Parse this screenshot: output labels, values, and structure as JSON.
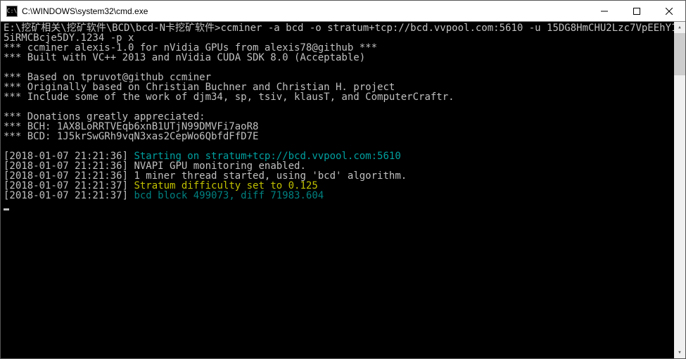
{
  "titlebar": {
    "icon_text": "C:\\",
    "title": "C:\\WINDOWS\\system32\\cmd.exe"
  },
  "terminal": {
    "prompt_path": "E:\\挖矿相关\\挖矿软件\\BCD\\bcd-N卡挖矿软件>",
    "command": "ccminer -a bcd -o stratum+tcp://bcd.vvpool.com:5610 -u 15DG8HmCHU2Lzc7VpEEhY15iRMCBcje5DY.1234 -p x",
    "banner": [
      "*** ccminer alexis-1.0 for nVidia GPUs from alexis78@github ***",
      "*** Built with VC++ 2013 and nVidia CUDA SDK 8.0 (Acceptable)",
      "",
      "*** Based on tpruvot@github ccminer",
      "*** Originally based on Christian Buchner and Christian H. project",
      "*** Include some of the work of djm34, sp, tsiv, klausT, and ComputerCraftr.",
      "",
      "*** Donations greatly appreciated:",
      "*** BCH: 1AX8LoRRTVEqb6xnB1UTjN99DMVFi7aoR8",
      "*** BCD: 1J5krSwGRh9vqN3xas2CepWo6QbfdFfD7E"
    ],
    "logs": [
      {
        "ts": "[2018-01-07 21:21:36]",
        "msg": "Starting on stratum+tcp://bcd.vvpool.com:5610",
        "color": "cyan"
      },
      {
        "ts": "[2018-01-07 21:21:36]",
        "msg": "NVAPI GPU monitoring enabled.",
        "color": "white"
      },
      {
        "ts": "[2018-01-07 21:21:36]",
        "msg": "1 miner thread started, using 'bcd' algorithm.",
        "color": "white"
      },
      {
        "ts": "[2018-01-07 21:21:37]",
        "msg": "Stratum difficulty set to 0.125",
        "color": "yellow"
      },
      {
        "ts": "[2018-01-07 21:21:37]",
        "msg": "bcd block 499073, diff 71983.604",
        "color": "teal"
      }
    ]
  }
}
